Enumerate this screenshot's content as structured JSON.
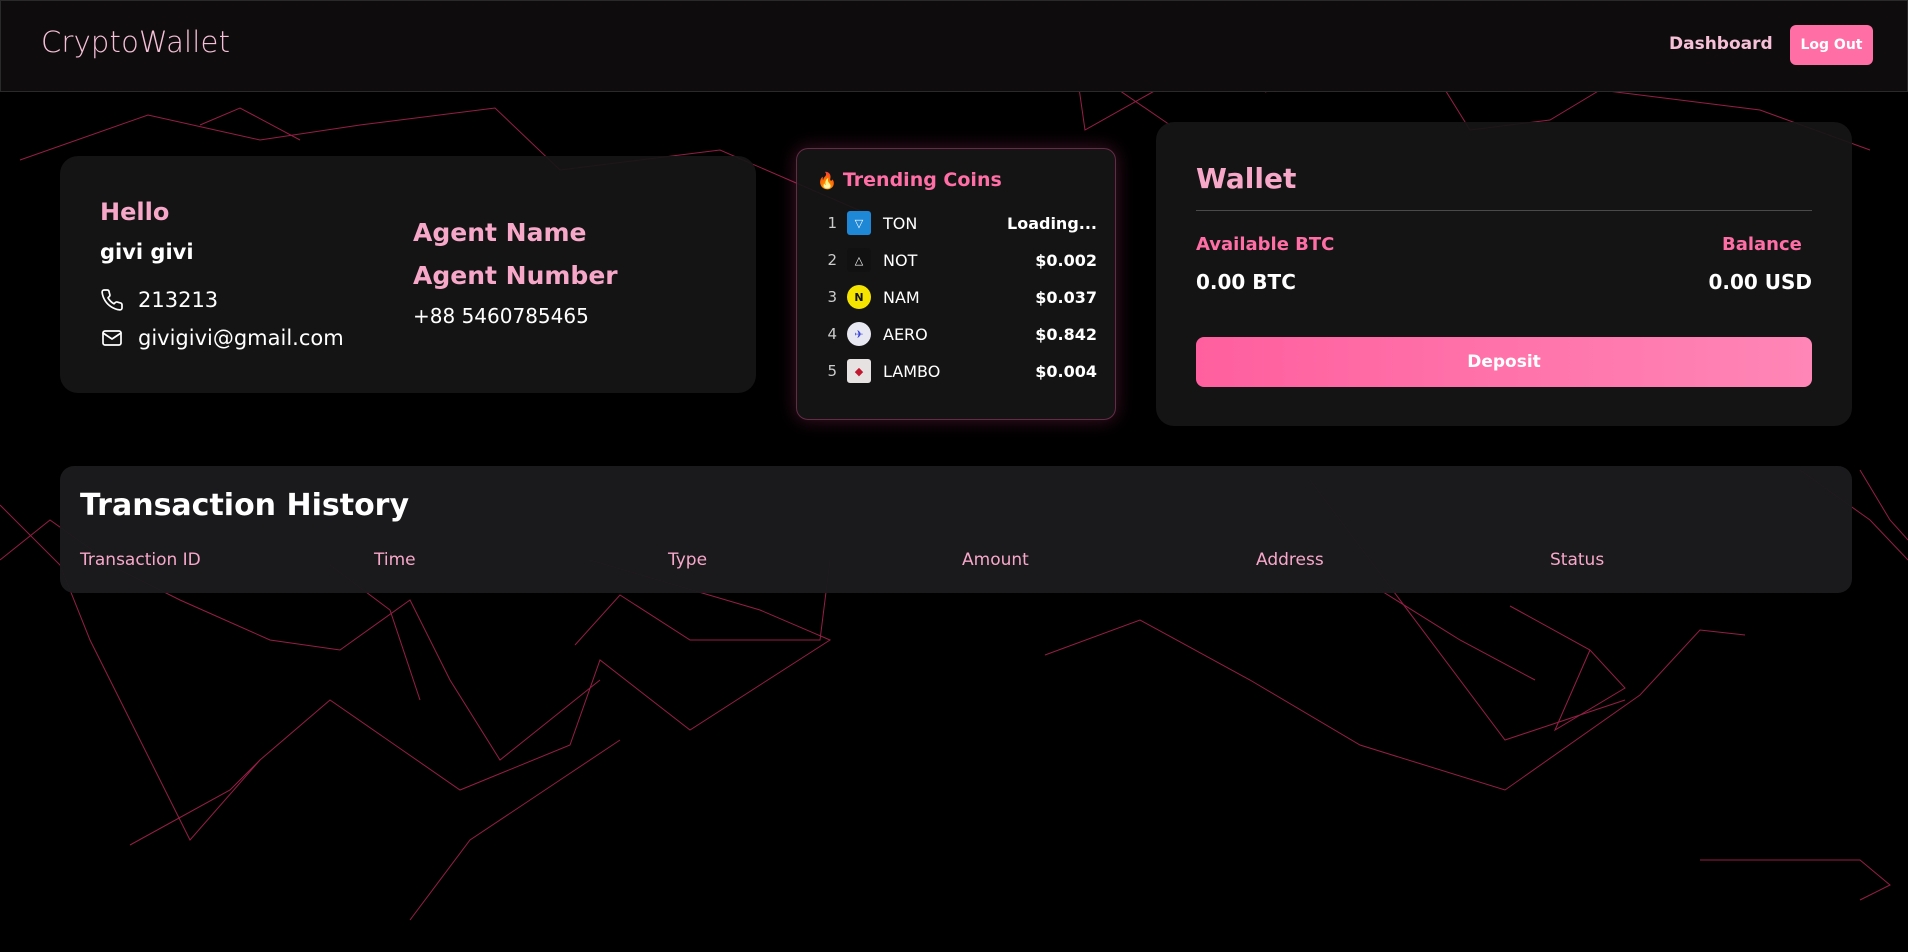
{
  "header": {
    "brand": "CryptoWallet",
    "nav_dashboard": "Dashboard",
    "logout_label": "Log Out"
  },
  "profile": {
    "greeting": "Hello",
    "username": "givi givi",
    "phone": "213213",
    "email": "givigivi@gmail.com",
    "phone_icon": "phone-icon",
    "email_icon": "mail-icon",
    "agent_name_label": "Agent Name",
    "agent_number_label": "Agent Number",
    "agent_number": "+88 5460785465"
  },
  "trending": {
    "title": "Trending Coins",
    "title_icon": "fire-icon",
    "coins": [
      {
        "rank": "1",
        "symbol": "TON",
        "price": "Loading...",
        "icon": "ton-logo",
        "icon_bg": "#1e88d6",
        "glyph": "▽"
      },
      {
        "rank": "2",
        "symbol": "NOT",
        "price": "$0.002",
        "icon": "not-logo",
        "icon_bg": "#111111",
        "glyph": "△"
      },
      {
        "rank": "3",
        "symbol": "NAM",
        "price": "$0.037",
        "icon": "nam-logo",
        "icon_bg": "#f5e400",
        "glyph": "N"
      },
      {
        "rank": "4",
        "symbol": "AERO",
        "price": "$0.842",
        "icon": "aero-logo",
        "icon_bg": "#e8e8f2",
        "glyph": "✈"
      },
      {
        "rank": "5",
        "symbol": "LAMBO",
        "price": "$0.004",
        "icon": "lambo-logo",
        "icon_bg": "#e7e2e2",
        "glyph": "◆"
      }
    ]
  },
  "wallet": {
    "title": "Wallet",
    "available_label": "Available BTC",
    "available_value": "0.00 BTC",
    "balance_label": "Balance",
    "balance_value": "0.00 USD",
    "deposit_label": "Deposit"
  },
  "transactions": {
    "title": "Transaction History",
    "columns": [
      "Transaction ID",
      "Time",
      "Type",
      "Amount",
      "Address",
      "Status"
    ]
  },
  "colors": {
    "accent": "#ff6fa5",
    "accent_light": "#f7a8c9",
    "background": "#000000",
    "card": "#161517"
  }
}
